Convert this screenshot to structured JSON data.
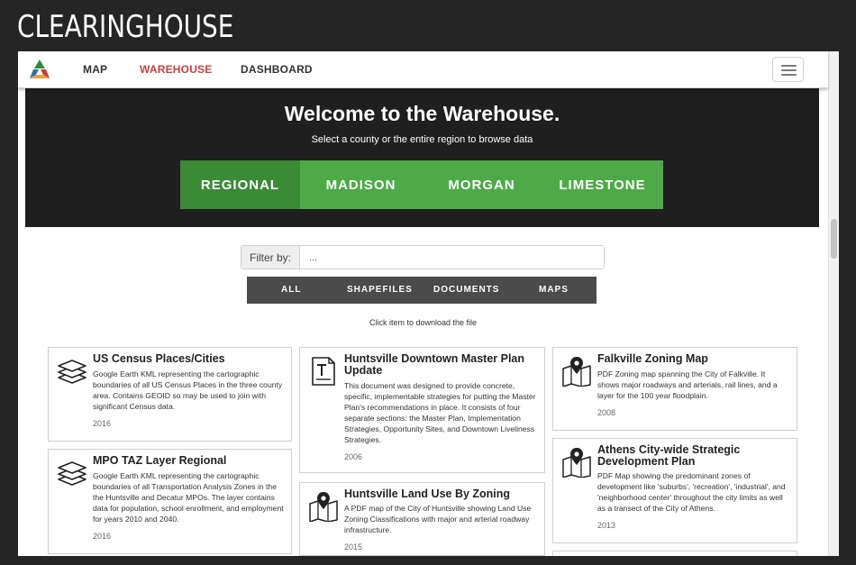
{
  "site": {
    "title": "CLEARINGHOUSE"
  },
  "nav": {
    "links": [
      {
        "label": "MAP"
      },
      {
        "label": "WAREHOUSE"
      },
      {
        "label": "DASHBOARD"
      }
    ]
  },
  "hero": {
    "title": "Welcome to the Warehouse.",
    "subtitle": "Select a county or the entire region to browse data",
    "regions": [
      {
        "label": "REGIONAL",
        "active": true
      },
      {
        "label": "MADISON"
      },
      {
        "label": "MORGAN"
      },
      {
        "label": "LIMESTONE"
      }
    ]
  },
  "filter": {
    "label": "Filter by:",
    "value": "...",
    "types": [
      {
        "label": "ALL"
      },
      {
        "label": "SHAPEFILES"
      },
      {
        "label": "DOCUMENTS"
      },
      {
        "label": "MAPS"
      }
    ],
    "hint": "Click item to download the file"
  },
  "colors": {
    "accent": "#c94040",
    "green": "#4eaa48",
    "green_active": "#3b8a36",
    "hero_bg": "#1f1f1f"
  },
  "cards": [
    {
      "icon": "layers-icon",
      "title": "US Census Places/Cities",
      "description": "Google Earth KML representing the cartographic boundaries of all US Census Places in the three county area. Contains GEOID so may be used to join with significant Census data.",
      "year": "2016"
    },
    {
      "icon": "layers-icon",
      "title": "MPO TAZ Layer Regional",
      "description": "Google Earth KML representing the cartographic boundaries of all Transportation Analysis Zones in the the Huntsville and Decatur MPOs. The layer contains data for population, school enrollment, and employment for years 2010 and 2040.",
      "year": "2016"
    },
    {
      "icon": "document-icon",
      "title": "Huntsville Downtown Master Plan Update",
      "description": "This document was designed to provide concrete, specific, implementable strategies for putting the Master Plan's recommendations in place. It consists of four separate sections: the Master Plan, Implementation Strategies, Opportunity Sites, and Downtown Liveliness Strategies.",
      "year": "2006"
    },
    {
      "icon": "map-icon",
      "title": "Huntsville Land Use By Zoning",
      "description": "A PDF map of the City of Huntsville showing Land Use Zoning Classifications with major and arterial roadway infrastructure.",
      "year": "2015"
    },
    {
      "icon": "map-icon",
      "title": "Falkville Zoning Map",
      "description": "PDF Zoning map spanning the City of Falkville. It shows major roadways and arterials, rail lines, and a layer for the 100 year floodplain.",
      "year": "2008"
    },
    {
      "icon": "map-icon",
      "title": "Athens City-wide Strategic Development Plan",
      "description": "PDF Map showing the predominant zones of development like 'suburbs', 'recreation', 'industrial', and 'neighborhood center' throughout the city limits as well as a transect of the City of Athens.",
      "year": "2013"
    }
  ]
}
